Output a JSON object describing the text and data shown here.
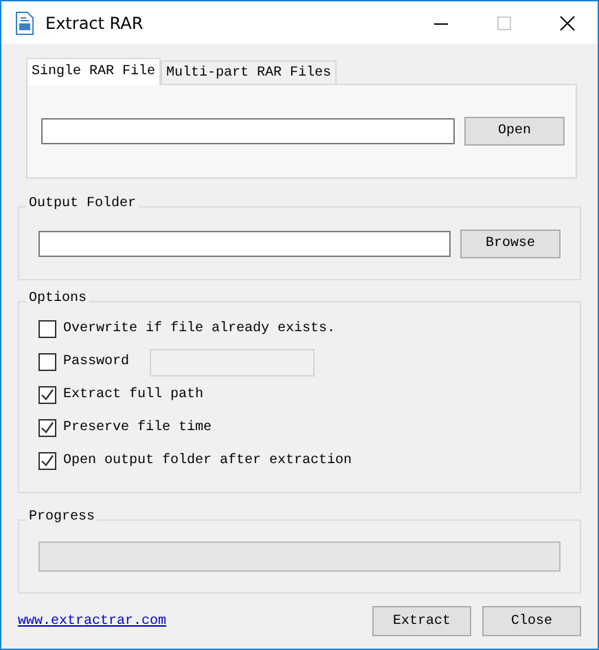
{
  "window": {
    "title": "Extract RAR"
  },
  "tabs": [
    {
      "label": "Single RAR File",
      "selected": true
    },
    {
      "label": "Multi-part RAR Files",
      "selected": false
    }
  ],
  "input_file": {
    "button": "Open"
  },
  "output_folder": {
    "title": "Output Folder",
    "button": "Browse"
  },
  "options": {
    "title": "Options",
    "items": [
      {
        "kind": "checkbox",
        "label": "Overwrite if file already exists.",
        "checked": false
      },
      {
        "kind": "password",
        "label": "Password",
        "checked": false,
        "field_disabled": true
      },
      {
        "kind": "checkbox",
        "label": "Extract full path",
        "checked": true
      },
      {
        "kind": "checkbox",
        "label": "Preserve file time",
        "checked": true
      },
      {
        "kind": "checkbox",
        "label": "Open output folder after extraction",
        "checked": true
      }
    ]
  },
  "progress": {
    "title": "Progress"
  },
  "footer": {
    "link": "www.extractrar.com",
    "buttons": [
      "Extract",
      "Close"
    ]
  }
}
